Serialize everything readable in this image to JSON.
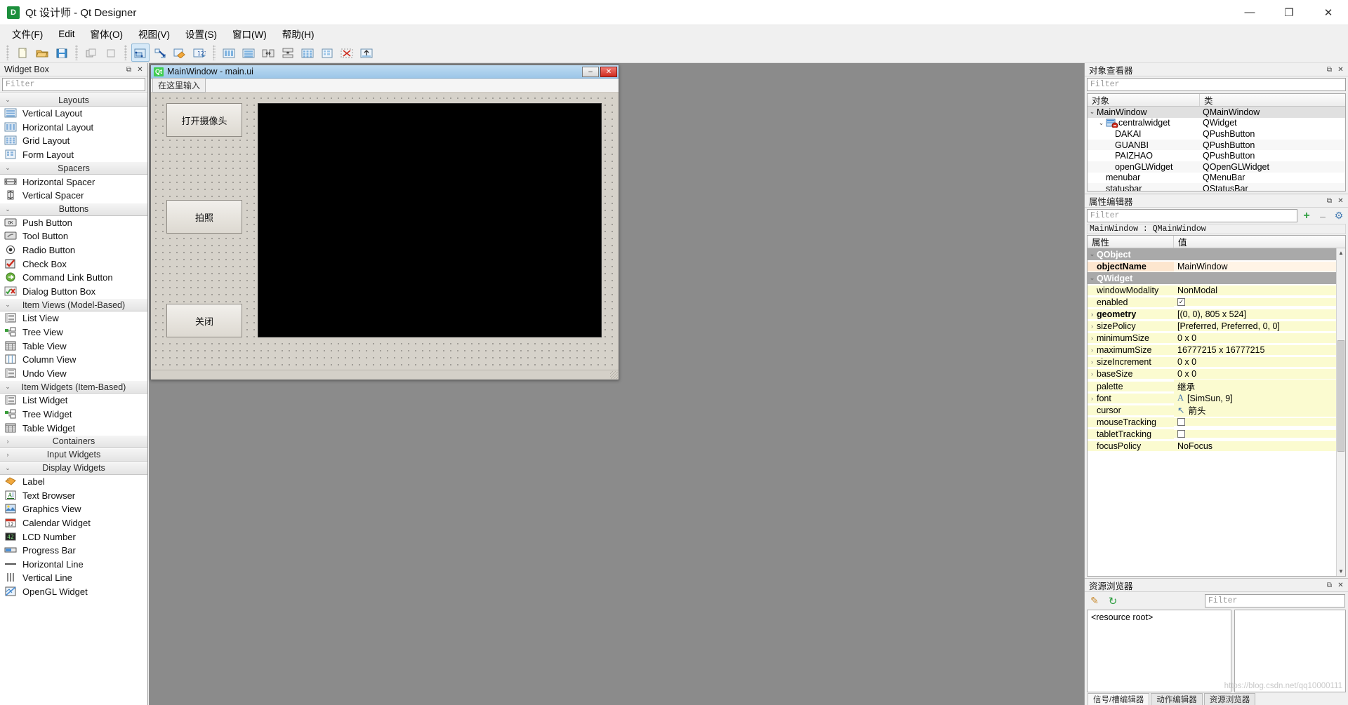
{
  "window": {
    "app_icon": "D",
    "title": "Qt 设计师 - Qt Designer",
    "minimize": "—",
    "maximize": "❐",
    "close": "✕"
  },
  "menubar": [
    {
      "label": "文件(F)",
      "name": "menu-file"
    },
    {
      "label": "Edit",
      "name": "menu-edit"
    },
    {
      "label": "窗体(O)",
      "name": "menu-form"
    },
    {
      "label": "视图(V)",
      "name": "menu-view"
    },
    {
      "label": "设置(S)",
      "name": "menu-settings"
    },
    {
      "label": "窗口(W)",
      "name": "menu-window"
    },
    {
      "label": "帮助(H)",
      "name": "menu-help"
    }
  ],
  "toolbar": {
    "groups": [
      {
        "buttons": [
          {
            "name": "new-form-icon",
            "glyph": "new"
          },
          {
            "name": "open-form-icon",
            "glyph": "open"
          },
          {
            "name": "save-form-icon",
            "glyph": "save"
          }
        ]
      },
      {
        "buttons": [
          {
            "name": "undo-icon",
            "glyph": "undo"
          },
          {
            "name": "redo-icon",
            "glyph": "redo"
          }
        ]
      },
      {
        "buttons": [
          {
            "name": "edit-widgets-icon",
            "glyph": "editwidgets",
            "active": true
          },
          {
            "name": "edit-signals-slots-icon",
            "glyph": "signals"
          },
          {
            "name": "edit-buddies-icon",
            "glyph": "buddies"
          },
          {
            "name": "edit-tab-order-icon",
            "glyph": "taborder"
          }
        ]
      },
      {
        "buttons": [
          {
            "name": "layout-horizontally-icon",
            "glyph": "lay-h"
          },
          {
            "name": "layout-vertically-icon",
            "glyph": "lay-v"
          },
          {
            "name": "layout-splitter-h-icon",
            "glyph": "lay-sph"
          },
          {
            "name": "layout-splitter-v-icon",
            "glyph": "lay-spv"
          },
          {
            "name": "layout-grid-icon",
            "glyph": "lay-grid"
          },
          {
            "name": "layout-form-icon",
            "glyph": "lay-form"
          },
          {
            "name": "break-layout-icon",
            "glyph": "lay-break"
          },
          {
            "name": "adjust-size-icon",
            "glyph": "adjust"
          }
        ]
      }
    ]
  },
  "widget_box": {
    "title": "Widget Box",
    "float_btn": "⧉",
    "close_btn": "✕",
    "filter_placeholder": "Filter",
    "groups": [
      {
        "name": "Layouts",
        "expanded": true,
        "items": [
          {
            "label": "Vertical Layout",
            "icon": "vertical-layout-icon"
          },
          {
            "label": "Horizontal Layout",
            "icon": "horizontal-layout-icon"
          },
          {
            "label": "Grid Layout",
            "icon": "grid-layout-icon"
          },
          {
            "label": "Form Layout",
            "icon": "form-layout-icon"
          }
        ]
      },
      {
        "name": "Spacers",
        "expanded": true,
        "items": [
          {
            "label": "Horizontal Spacer",
            "icon": "horizontal-spacer-icon"
          },
          {
            "label": "Vertical Spacer",
            "icon": "vertical-spacer-icon"
          }
        ]
      },
      {
        "name": "Buttons",
        "expanded": true,
        "items": [
          {
            "label": "Push Button",
            "icon": "push-button-icon"
          },
          {
            "label": "Tool Button",
            "icon": "tool-button-icon"
          },
          {
            "label": "Radio Button",
            "icon": "radio-button-icon"
          },
          {
            "label": "Check Box",
            "icon": "check-box-icon"
          },
          {
            "label": "Command Link Button",
            "icon": "command-link-button-icon"
          },
          {
            "label": "Dialog Button Box",
            "icon": "dialog-button-box-icon"
          }
        ]
      },
      {
        "name": "Item Views (Model-Based)",
        "expanded": true,
        "items": [
          {
            "label": "List View",
            "icon": "list-view-icon"
          },
          {
            "label": "Tree View",
            "icon": "tree-view-icon"
          },
          {
            "label": "Table View",
            "icon": "table-view-icon"
          },
          {
            "label": "Column View",
            "icon": "column-view-icon"
          },
          {
            "label": "Undo View",
            "icon": "undo-view-icon"
          }
        ]
      },
      {
        "name": "Item Widgets (Item-Based)",
        "expanded": true,
        "items": [
          {
            "label": "List Widget",
            "icon": "list-widget-icon"
          },
          {
            "label": "Tree Widget",
            "icon": "tree-widget-icon"
          },
          {
            "label": "Table Widget",
            "icon": "table-widget-icon"
          }
        ]
      },
      {
        "name": "Containers",
        "expanded": false,
        "items": []
      },
      {
        "name": "Input Widgets",
        "expanded": false,
        "items": []
      },
      {
        "name": "Display Widgets",
        "expanded": true,
        "items": [
          {
            "label": "Label",
            "icon": "label-icon"
          },
          {
            "label": "Text Browser",
            "icon": "text-browser-icon"
          },
          {
            "label": "Graphics View",
            "icon": "graphics-view-icon"
          },
          {
            "label": "Calendar Widget",
            "icon": "calendar-widget-icon"
          },
          {
            "label": "LCD Number",
            "icon": "lcd-number-icon"
          },
          {
            "label": "Progress Bar",
            "icon": "progress-bar-icon"
          },
          {
            "label": "Horizontal Line",
            "icon": "horizontal-line-icon"
          },
          {
            "label": "Vertical Line",
            "icon": "vertical-line-icon"
          },
          {
            "label": "OpenGL Widget",
            "icon": "opengl-widget-icon"
          }
        ]
      }
    ]
  },
  "form_window": {
    "qt_badge": "Qt",
    "title": "MainWindow - main.ui",
    "minimize": "–",
    "close": "✕",
    "menu_hint": "在这里输入",
    "buttons": [
      {
        "label": "打开摄像头",
        "name": "form-button-dakai"
      },
      {
        "label": "拍照",
        "name": "form-button-paizhao"
      },
      {
        "label": "关闭",
        "name": "form-button-guanbi"
      }
    ],
    "gl_widget_name": "openGLWidget"
  },
  "object_inspector": {
    "title": "对象查看器",
    "float_btn": "⧉",
    "close_btn": "✕",
    "filter_placeholder": "Filter",
    "columns": [
      "对象",
      "类"
    ],
    "rows": [
      {
        "object": "MainWindow",
        "class": "QMainWindow",
        "indent": 0,
        "chevron": "⌄",
        "icon": "",
        "selected": true
      },
      {
        "object": "centralwidget",
        "class": "QWidget",
        "indent": 1,
        "chevron": "⌄",
        "icon": "central-widget-icon",
        "selected": false
      },
      {
        "object": "DAKAI",
        "class": "QPushButton",
        "indent": 2,
        "chevron": "",
        "icon": "",
        "selected": false
      },
      {
        "object": "GUANBI",
        "class": "QPushButton",
        "indent": 2,
        "chevron": "",
        "icon": "",
        "selected": false,
        "alt": true
      },
      {
        "object": "PAIZHAO",
        "class": "QPushButton",
        "indent": 2,
        "chevron": "",
        "icon": "",
        "selected": false
      },
      {
        "object": "openGLWidget",
        "class": "QOpenGLWidget",
        "indent": 2,
        "chevron": "",
        "icon": "",
        "selected": false,
        "alt": true
      },
      {
        "object": "menubar",
        "class": "QMenuBar",
        "indent": 1,
        "chevron": "",
        "icon": "",
        "selected": false
      },
      {
        "object": "statusbar",
        "class": "QStatusBar",
        "indent": 1,
        "chevron": "",
        "icon": "",
        "selected": false,
        "alt": true
      }
    ]
  },
  "property_editor": {
    "title": "属性编辑器",
    "float_btn": "⧉",
    "close_btn": "✕",
    "filter_placeholder": "Filter",
    "add_icon": "+",
    "remove_icon": "–",
    "config_icon": "⚙",
    "object_line": "MainWindow : QMainWindow",
    "columns": [
      "属性",
      "值"
    ],
    "rows": [
      {
        "kind": "group",
        "name": "QObject",
        "value": "",
        "chevron": "⌄"
      },
      {
        "kind": "orange",
        "name": "objectName",
        "value": "MainWindow",
        "chevron": ""
      },
      {
        "kind": "group",
        "name": "QWidget",
        "value": "",
        "chevron": "⌄"
      },
      {
        "kind": "yellow",
        "name": "windowModality",
        "value": "NonModal",
        "chevron": ""
      },
      {
        "kind": "yellow",
        "name": "enabled",
        "value": "",
        "checkbox": true,
        "checked": true,
        "chevron": ""
      },
      {
        "kind": "yellow",
        "name": "geometry",
        "value": "[(0, 0), 805 x 524]",
        "chevron": "›",
        "bold": true
      },
      {
        "kind": "yellow",
        "name": "sizePolicy",
        "value": "[Preferred, Preferred, 0, 0]",
        "chevron": "›"
      },
      {
        "kind": "yellow",
        "name": "minimumSize",
        "value": "0 x 0",
        "chevron": "›"
      },
      {
        "kind": "yellow",
        "name": "maximumSize",
        "value": "16777215 x 16777215",
        "chevron": "›"
      },
      {
        "kind": "yellow",
        "name": "sizeIncrement",
        "value": "0 x 0",
        "chevron": "›"
      },
      {
        "kind": "yellow",
        "name": "baseSize",
        "value": "0 x 0",
        "chevron": "›"
      },
      {
        "kind": "yellow",
        "name": "palette",
        "value": "继承",
        "chevron": ""
      },
      {
        "kind": "yellow",
        "name": "font",
        "value": "[SimSun, 9]",
        "prefix": "A",
        "chevron": "›"
      },
      {
        "kind": "yellow",
        "name": "cursor",
        "value": "箭头",
        "prefix": "↖",
        "chevron": ""
      },
      {
        "kind": "yellow",
        "name": "mouseTracking",
        "value": "",
        "checkbox": true,
        "checked": false,
        "chevron": ""
      },
      {
        "kind": "yellow",
        "name": "tabletTracking",
        "value": "",
        "checkbox": true,
        "checked": false,
        "chevron": ""
      },
      {
        "kind": "yellow",
        "name": "focusPolicy",
        "value": "NoFocus",
        "chevron": ""
      }
    ]
  },
  "resource_browser": {
    "title": "资源浏览器",
    "float_btn": "⧉",
    "close_btn": "✕",
    "edit_icon": "✎",
    "reload_icon": "↻",
    "filter_placeholder": "Filter",
    "root_label": "<resource root>",
    "watermark": "https://blog.csdn.net/qq10000111",
    "tabs": [
      {
        "label": "信号/槽编辑器",
        "selected": true
      },
      {
        "label": "动作编辑器",
        "selected": false
      },
      {
        "label": "资源浏览器",
        "selected": false
      }
    ]
  },
  "colors": {
    "chrome": "#f0f0f0",
    "canvas": "#8b8b8b",
    "form_bg": "#d4d0c8",
    "gl_black": "#000000",
    "group_row": "#a9a9a9",
    "yellow_row": "#fbfbd0",
    "orange_row": "#fde6cf",
    "title_active": "#9cc6e8"
  }
}
